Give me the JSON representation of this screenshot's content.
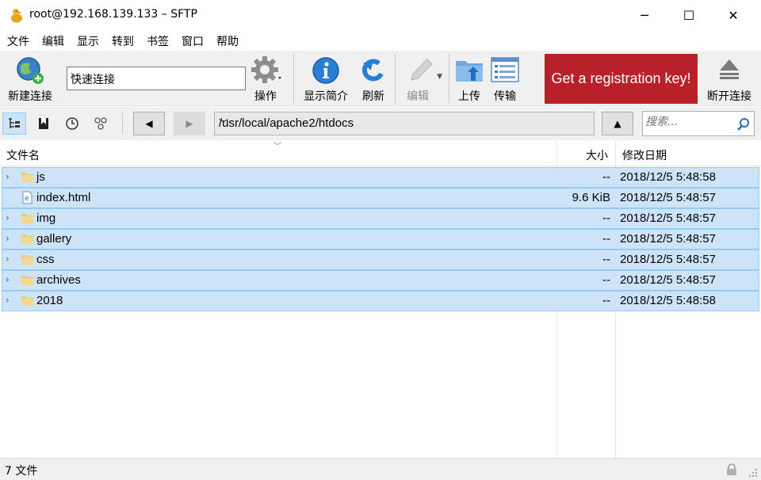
{
  "window": {
    "title": "root@192.168.139.133 – SFTP",
    "minimize_glyph": "─",
    "maximize_glyph": "☐",
    "close_glyph": "✕"
  },
  "menu": [
    "文件",
    "编辑",
    "显示",
    "转到",
    "书签",
    "窗口",
    "帮助"
  ],
  "toolbar": {
    "new_connection": "新建连接",
    "quick_connect_value": "快速连接",
    "actions": "操作",
    "info": "显示简介",
    "refresh": "刷新",
    "edit": "编辑",
    "upload": "上传",
    "transfers": "传输",
    "registration": "Get a registration key!",
    "disconnect": "断开连接"
  },
  "navbar": {
    "back_glyph": "◀",
    "forward_glyph": "▶",
    "up_glyph": "▲",
    "path": "/usr/local/apache2/htdocs",
    "search_placeholder": "搜索..."
  },
  "columns": {
    "name": "文件名",
    "size": "大小",
    "modified": "修改日期"
  },
  "files": [
    {
      "name": "js",
      "type": "folder",
      "size": "--",
      "modified": "2018/12/5 5:48:58"
    },
    {
      "name": "index.html",
      "type": "html-file",
      "size": "9.6 KiB",
      "modified": "2018/12/5 5:48:57"
    },
    {
      "name": "img",
      "type": "folder",
      "size": "--",
      "modified": "2018/12/5 5:48:57"
    },
    {
      "name": "gallery",
      "type": "folder",
      "size": "--",
      "modified": "2018/12/5 5:48:57"
    },
    {
      "name": "css",
      "type": "folder",
      "size": "--",
      "modified": "2018/12/5 5:48:57"
    },
    {
      "name": "archives",
      "type": "folder",
      "size": "--",
      "modified": "2018/12/5 5:48:57"
    },
    {
      "name": "2018",
      "type": "folder",
      "size": "--",
      "modified": "2018/12/5 5:48:58"
    }
  ],
  "status": {
    "count": "7 文件"
  },
  "colors": {
    "registration_bg": "#b8202a",
    "selection_bg": "#cde3f7",
    "selection_border": "#99c9ef"
  }
}
